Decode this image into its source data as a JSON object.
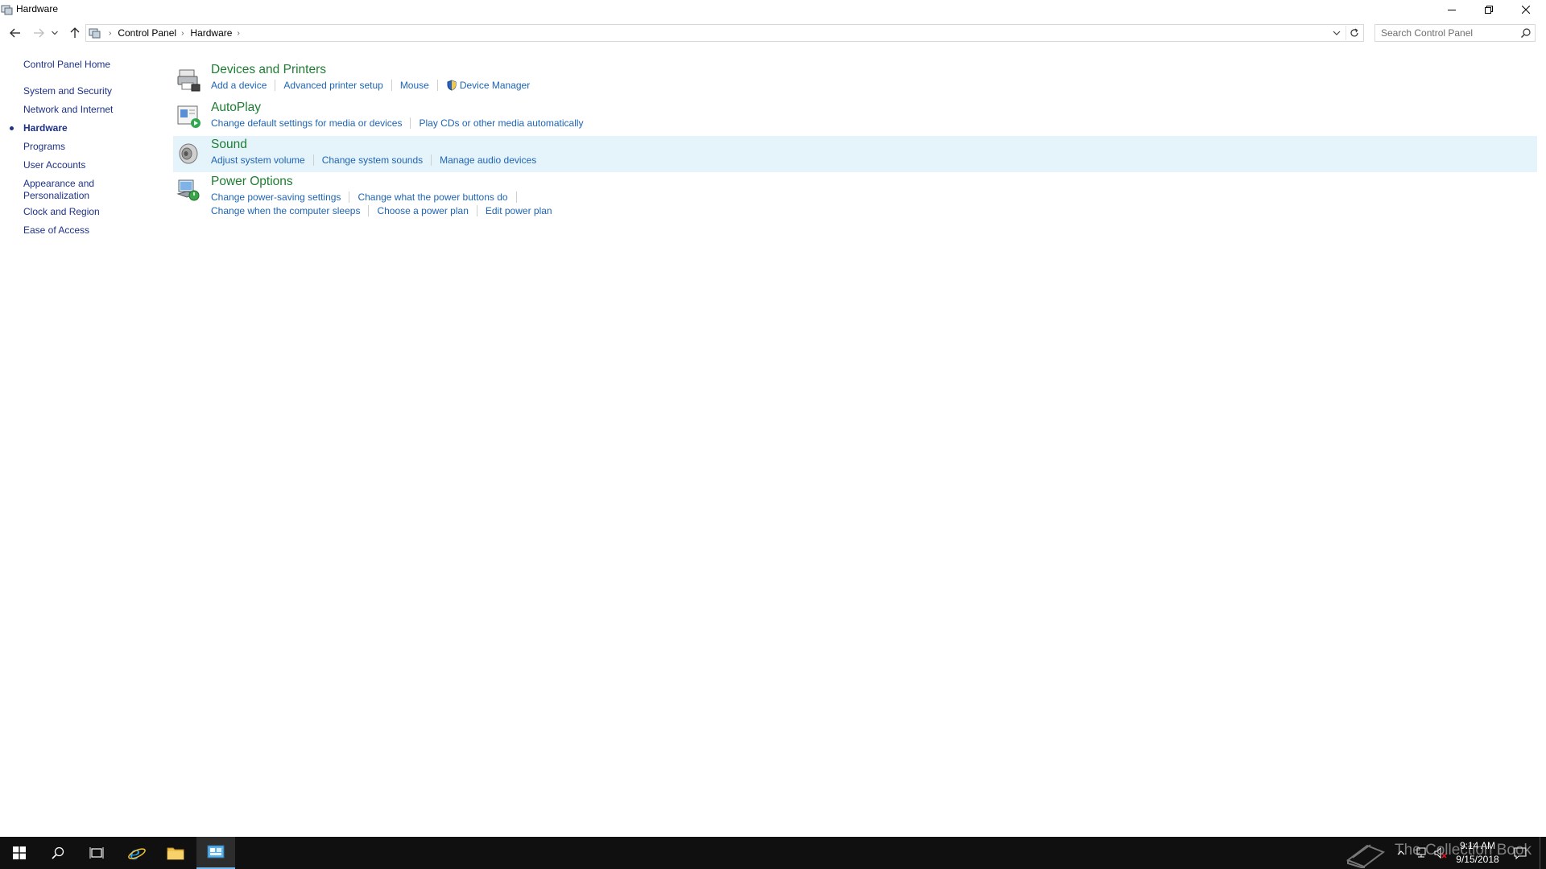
{
  "window": {
    "title": "Hardware"
  },
  "address": {
    "crumbs": [
      "Control Panel",
      "Hardware"
    ]
  },
  "search": {
    "placeholder": "Search Control Panel"
  },
  "leftnav": {
    "home": "Control Panel Home",
    "items": [
      {
        "label": "System and Security",
        "current": false
      },
      {
        "label": "Network and Internet",
        "current": false
      },
      {
        "label": "Hardware",
        "current": true
      },
      {
        "label": "Programs",
        "current": false
      },
      {
        "label": "User Accounts",
        "current": false
      },
      {
        "label": "Appearance and Personalization",
        "current": false
      },
      {
        "label": "Clock and Region",
        "current": false
      },
      {
        "label": "Ease of Access",
        "current": false
      }
    ]
  },
  "categories": [
    {
      "title": "Devices and Printers",
      "icon": "devices-printers-icon",
      "links": [
        "Add a device",
        "Advanced printer setup",
        "Mouse",
        "Device Manager"
      ]
    },
    {
      "title": "AutoPlay",
      "icon": "autoplay-icon",
      "links": [
        "Change default settings for media or devices",
        "Play CDs or other media automatically"
      ]
    },
    {
      "title": "Sound",
      "icon": "speaker-icon",
      "links": [
        "Adjust system volume",
        "Change system sounds",
        "Manage audio devices"
      ]
    },
    {
      "title": "Power Options",
      "icon": "power-options-icon",
      "links": [
        "Change power-saving settings",
        "Change what the power buttons do"
      ],
      "links2": [
        "Change when the computer sleeps",
        "Choose a power plan",
        "Edit power plan"
      ]
    }
  ],
  "taskbar": {
    "time": "9:14 AM",
    "date": "9/15/2018",
    "watermark": "The Collection Book"
  },
  "colors": {
    "category_title": "#1e7d32",
    "link": "#1e64b4",
    "nav": "#1e3287",
    "hover_row": "#e5f3fb",
    "taskbar": "#101010"
  }
}
